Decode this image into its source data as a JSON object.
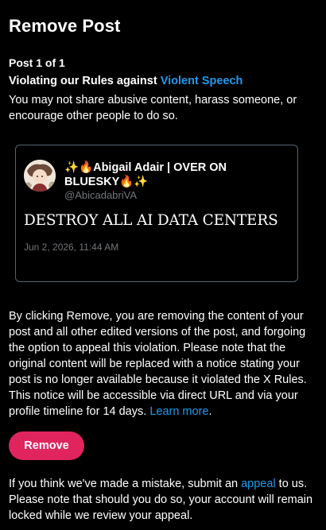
{
  "page": {
    "title": "Remove Post",
    "post_count": "Post 1 of 1"
  },
  "violation": {
    "heading_prefix": "Violating our Rules against ",
    "rule_link": "Violent Speech",
    "description": "You may not share abusive content, harass someone, or encourage other people to do so."
  },
  "post": {
    "author_name": "✨🔥Abigail Adair | OVER ON BLUESKY🔥✨",
    "author_handle": "@AbicadabriVA",
    "text": "DESTROY ALL AI DATA CENTERS",
    "timestamp": "Jun 2, 2026, 11:44 AM",
    "avatar_icon": "profile-avatar-illustration"
  },
  "remove_info": {
    "text": "By clicking Remove, you are removing the content of your post and all other edited versions of the post, and forgoing the option to appeal this violation. Please note that the original content will be replaced with a notice stating your post is no longer available because it violated the X Rules. This notice will be accessible via direct URL and via your profile timeline for 14 days.",
    "learn_more": "Learn more",
    "suffix": "."
  },
  "actions": {
    "remove_label": "Remove"
  },
  "appeal_info": {
    "prefix": "If you think we've made a mistake, submit an ",
    "link": "appeal",
    "suffix": " to us. Please note that should you do so, your account will remain locked while we review your appeal."
  },
  "colors": {
    "background": "#000000",
    "text": "#ffffff",
    "link": "#1d9bf0",
    "secondary_text": "#71767b",
    "card_border": "#536471",
    "remove_button": "#e0245e"
  }
}
